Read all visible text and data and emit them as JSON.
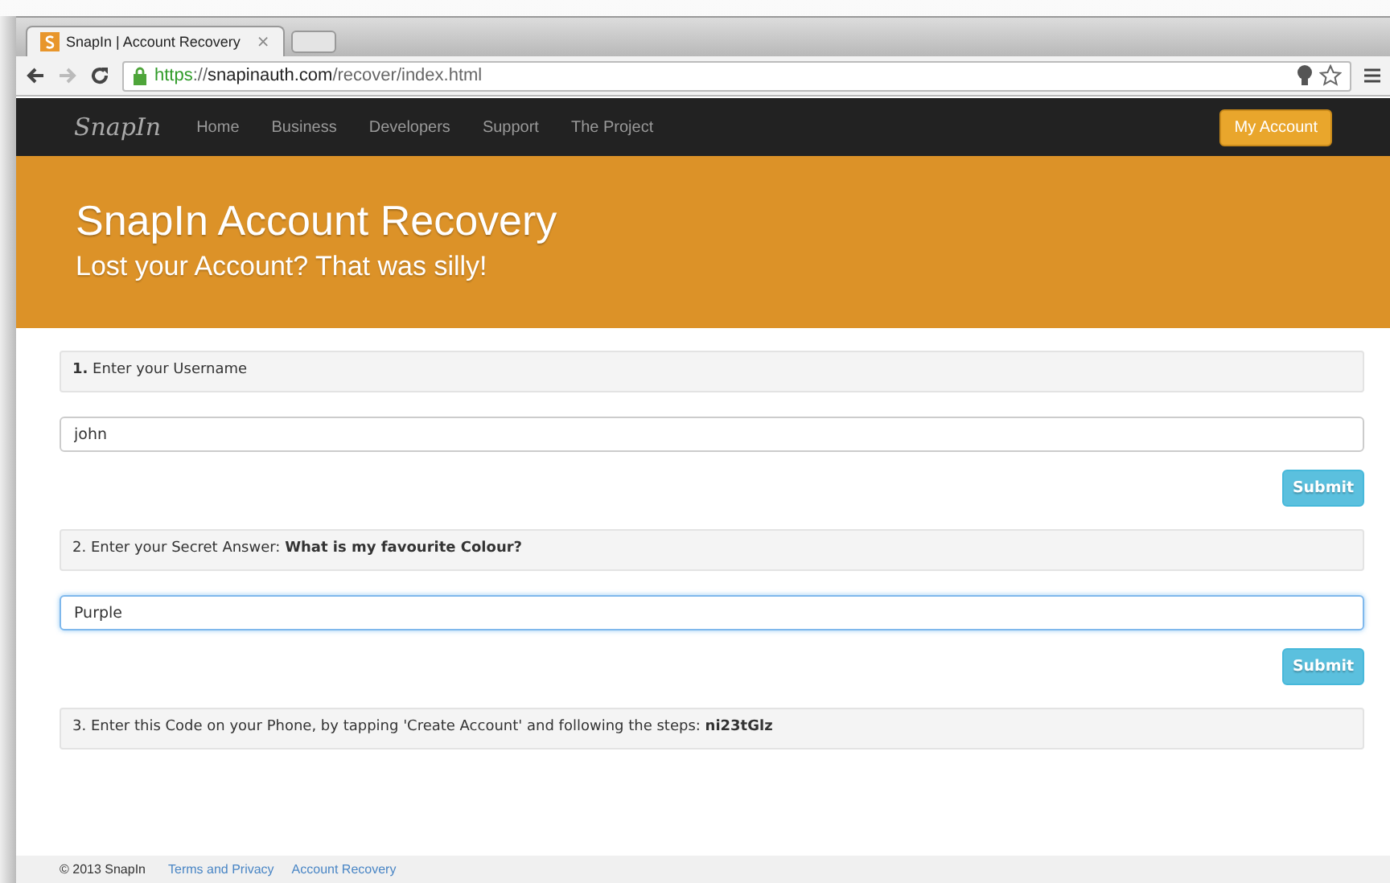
{
  "browser": {
    "tab": {
      "title": "SnapIn | Account Recovery",
      "close": "×"
    },
    "url": [
      {
        "text": "https",
        "kind": "scheme"
      },
      {
        "text": "://",
        "kind": "plain"
      },
      {
        "text": "snapinauth.com",
        "kind": "host"
      },
      {
        "text": "/recover/index.html",
        "kind": "plain"
      }
    ]
  },
  "navbar": {
    "brand": "SnapIn",
    "items": [
      "Home",
      "Business",
      "Developers",
      "Support",
      "The Project"
    ],
    "account_button": "My Account"
  },
  "hero": {
    "title": "SnapIn Account Recovery",
    "subtitle": "Lost your Account? That was silly!"
  },
  "steps": [
    {
      "label": "**1.** Enter your Username",
      "field": {
        "value": "john",
        "focused": false
      },
      "button": "Submit"
    },
    {
      "label": "2. Enter your Secret Answer: **What is my favourite Colour?**",
      "field": {
        "value": "Purple",
        "focused": true
      },
      "button": "Submit"
    },
    {
      "label": "3. Enter this Code on your Phone, by tapping 'Create Account' and following the steps: **ni23tGlz**"
    }
  ],
  "footer": {
    "copyright": "© 2013 SnapIn",
    "links": [
      "Terms and Privacy",
      "Account Recovery"
    ]
  }
}
